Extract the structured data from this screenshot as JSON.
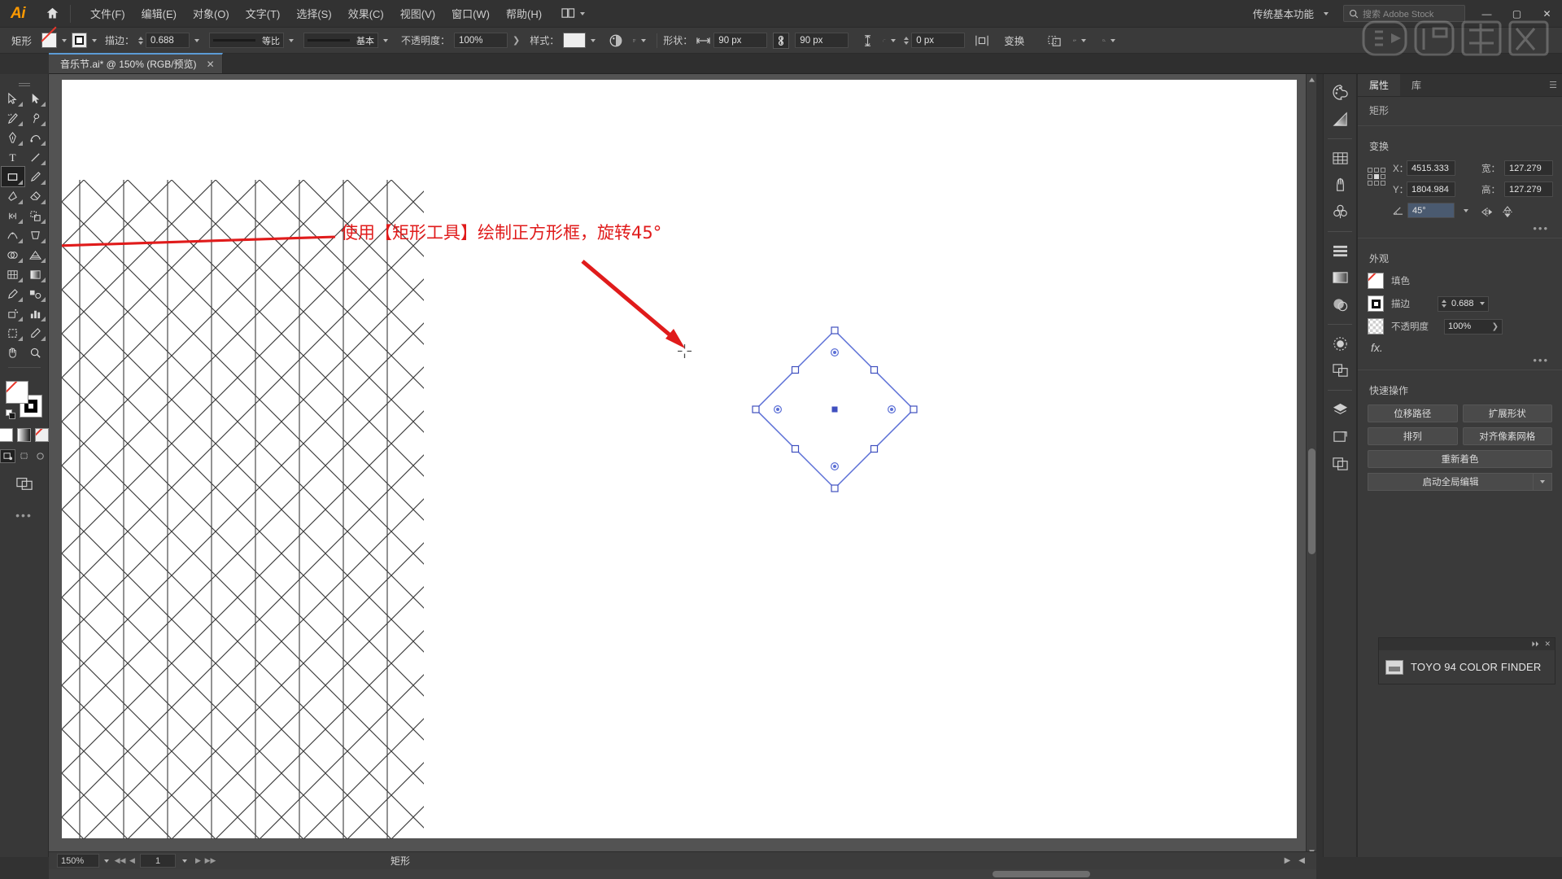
{
  "app": {
    "logo_text": "Ai",
    "workspace": "传统基本功能",
    "search_placeholder": "搜索 Adobe Stock"
  },
  "menu": {
    "items": [
      {
        "label": "文件(F)"
      },
      {
        "label": "编辑(E)"
      },
      {
        "label": "对象(O)"
      },
      {
        "label": "文字(T)"
      },
      {
        "label": "选择(S)"
      },
      {
        "label": "效果(C)"
      },
      {
        "label": "视图(V)"
      },
      {
        "label": "窗口(W)"
      },
      {
        "label": "帮助(H)"
      }
    ]
  },
  "control_bar": {
    "object_label": "矩形",
    "stroke_label": "描边：",
    "stroke_weight": "0.688 ",
    "profile_name": "等比",
    "brush_name": "基本",
    "opacity_label": "不透明度：",
    "opacity_value": "100%",
    "style_label": "样式：",
    "shape_label": "形状：",
    "width_value": "90 px",
    "height_value": "90 px",
    "corner_value": "0 px",
    "transform_label": "变换"
  },
  "tab": {
    "title": "音乐节.ai* @ 150% (RGB/预览)",
    "close": "✕"
  },
  "toolbar": {
    "tools": [
      {
        "name": "selection-tool",
        "label": "选择工具"
      },
      {
        "name": "direct-selection-tool",
        "label": "直接选择工具"
      },
      {
        "name": "magic-wand-tool",
        "label": "魔棒工具"
      },
      {
        "name": "lasso-tool",
        "label": "套索工具"
      },
      {
        "name": "pen-tool",
        "label": "钢笔工具"
      },
      {
        "name": "curvature-tool",
        "label": "曲率工具"
      },
      {
        "name": "type-tool",
        "label": "文字工具"
      },
      {
        "name": "line-segment-tool",
        "label": "直线段工具"
      },
      {
        "name": "rectangle-tool",
        "label": "矩形工具"
      },
      {
        "name": "paintbrush-tool",
        "label": "画笔工具"
      },
      {
        "name": "shaper-tool",
        "label": "Shaper 工具"
      },
      {
        "name": "eraser-tool",
        "label": "橡皮擦工具"
      },
      {
        "name": "rotate-tool",
        "label": "旋转工具"
      },
      {
        "name": "scale-tool",
        "label": "比例缩放工具"
      },
      {
        "name": "width-tool",
        "label": "宽度工具"
      },
      {
        "name": "free-transform-tool",
        "label": "自由变换工具"
      },
      {
        "name": "shape-builder-tool",
        "label": "形状生成器工具"
      },
      {
        "name": "perspective-grid-tool",
        "label": "透视网格工具"
      },
      {
        "name": "mesh-tool",
        "label": "网格工具"
      },
      {
        "name": "gradient-tool",
        "label": "渐变工具"
      },
      {
        "name": "eyedropper-tool",
        "label": "吸管工具"
      },
      {
        "name": "blend-tool",
        "label": "混合工具"
      },
      {
        "name": "symbol-sprayer-tool",
        "label": "符号喷枪工具"
      },
      {
        "name": "column-graph-tool",
        "label": "柱形图工具"
      },
      {
        "name": "artboard-tool",
        "label": "画板工具"
      },
      {
        "name": "slice-tool",
        "label": "切片工具"
      },
      {
        "name": "hand-tool",
        "label": "抓手工具"
      },
      {
        "name": "zoom-tool",
        "label": "缩放工具"
      }
    ],
    "active_tool": "rectangle-tool",
    "fill_state": "none",
    "stroke_state": "black",
    "more_dots": "•••"
  },
  "canvas": {
    "annotation": "使用【矩形工具】绘制正方形框，旋转45°",
    "annotation_color": "#e01b1b"
  },
  "status_bar": {
    "zoom": "150%",
    "page": "1",
    "tool_name": "矩形"
  },
  "right_rail": {
    "groups": [
      [
        "color-panel-icon",
        "gradient-panel-icon"
      ],
      [
        "swatches-panel-icon",
        "brushes-panel-icon",
        "symbols-panel-icon"
      ],
      [
        "align-panel-icon",
        "appearance-panel-icon",
        "graphic-styles-panel-icon"
      ],
      [
        "transparency-panel-icon",
        "pathfinder-panel-icon"
      ],
      [
        "layers-panel-icon",
        "artboards-panel-icon",
        "links-panel-icon"
      ]
    ]
  },
  "properties": {
    "tabs": [
      {
        "label": "属性",
        "active": true
      },
      {
        "label": "库",
        "active": false
      }
    ],
    "object_name": "矩形",
    "transform": {
      "title": "变换",
      "x_label": "X：",
      "x_value": "4515.333",
      "y_label": "Y：",
      "y_value": "1804.984",
      "w_label": "宽：",
      "w_value": "127.279",
      "h_label": "高：",
      "h_value": "127.279",
      "angle_value": "45°",
      "more": "•••"
    },
    "appearance": {
      "title": "外观",
      "fill_label": "填色",
      "stroke_label": "描边",
      "stroke_value": "0.688",
      "opacity_label": "不透明度",
      "opacity_value": "100%",
      "fx_label": "fx.",
      "more": "•••"
    },
    "quick_actions": {
      "title": "快速操作",
      "buttons": [
        {
          "label": "位移路径"
        },
        {
          "label": "扩展形状"
        },
        {
          "label": "排列"
        },
        {
          "label": "对齐像素网格"
        },
        {
          "label": "重新着色"
        }
      ],
      "global_edit": "启动全局编辑"
    }
  },
  "toyo_panel": {
    "title": "TOYO 94 COLOR FINDER",
    "collapse": "⏵⏵",
    "close": "✕"
  },
  "window_controls": {
    "minimize": "—",
    "maximize": "▢",
    "close": "✕"
  }
}
